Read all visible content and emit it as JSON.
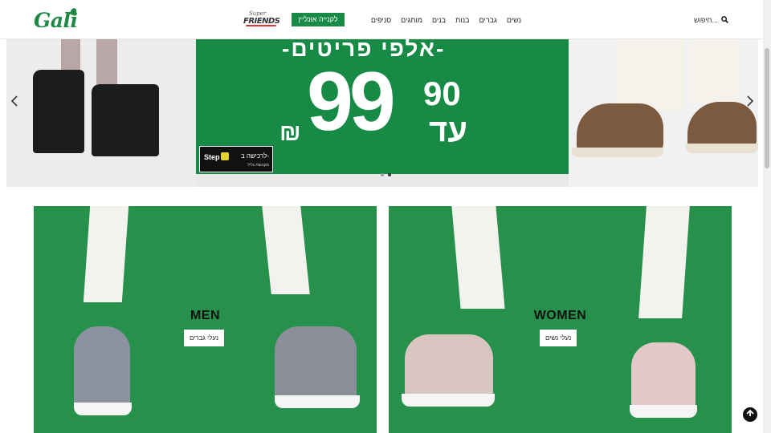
{
  "header": {
    "logo": "Gali",
    "friends_logo_small": "Super",
    "friends_logo_big": "FRIENDS",
    "cta_label": "לקנייה אונליין",
    "nav_items": [
      "נשים",
      "גברים",
      "בנות",
      "בנים",
      "מותגים",
      "סניפים"
    ],
    "search_placeholder": "חיפוש...",
    "search_icon": "search-icon"
  },
  "hero": {
    "headline": "-אלפי פריטים-",
    "price_main": "99",
    "price_cents": "90",
    "price_prefix": "עד",
    "currency": "₪",
    "badge_text": "לרכישה ב-",
    "badge_logo": "Step",
    "badge_sub": "מקבוצת גליל",
    "prev_icon": "chevron-left-icon",
    "next_icon": "chevron-right-icon",
    "slides_count": 2,
    "active_slide": 2
  },
  "tiles": {
    "men": {
      "title": "MEN",
      "button": "נעלי גברים"
    },
    "women": {
      "title": "WOMEN",
      "button": "נעלי נשים"
    }
  },
  "colors": {
    "brand_green": "#178a45",
    "tile_green": "#27904b"
  },
  "back_to_top_icon": "arrow-up-icon"
}
